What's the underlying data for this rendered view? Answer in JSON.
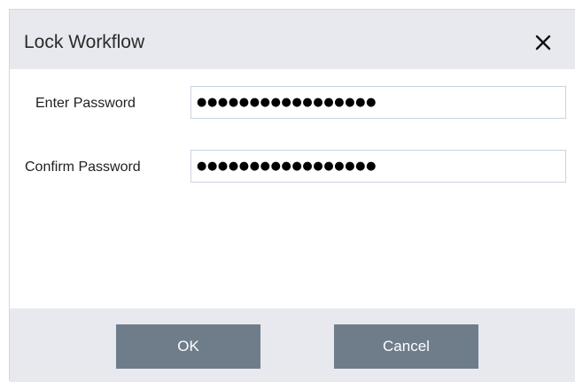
{
  "dialog": {
    "title": "Lock Workflow",
    "close_icon": "close-icon"
  },
  "form": {
    "password_label": "Enter Password",
    "password_value": "●●●●●●●●●●●●●●●●●",
    "confirm_label": "Confirm Password",
    "confirm_value": "●●●●●●●●●●●●●●●●●"
  },
  "footer": {
    "ok_label": "OK",
    "cancel_label": "Cancel"
  },
  "colors": {
    "header_bg": "#e7e9ee",
    "button_bg": "#6f7d8b",
    "input_border": "#c9d3e4"
  }
}
